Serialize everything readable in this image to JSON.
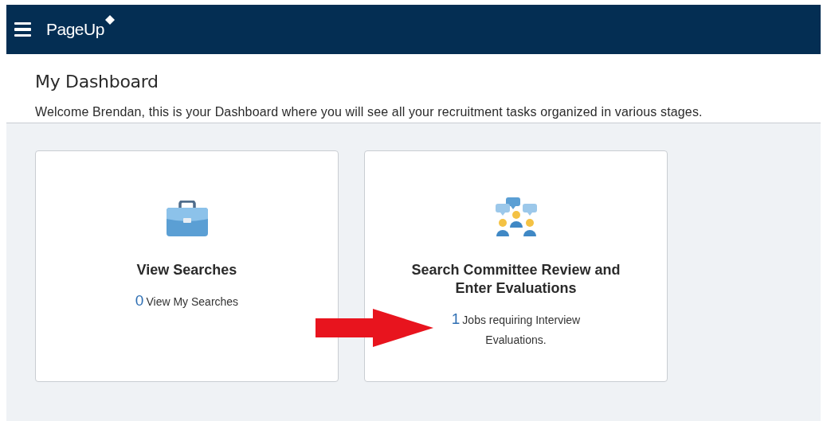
{
  "header": {
    "logo": "PageUp"
  },
  "page": {
    "title": "My Dashboard",
    "welcome": "Welcome Brendan, this is your Dashboard where you will see all your recruitment tasks organized in various stages."
  },
  "cards": [
    {
      "kind": "briefcase",
      "title": "View Searches",
      "count": "0",
      "text": "View My Searches"
    },
    {
      "kind": "committee",
      "title": "Search Committee Review and Enter Evaluations",
      "count": "1",
      "text": "Jobs requiring Interview Evaluations."
    }
  ]
}
